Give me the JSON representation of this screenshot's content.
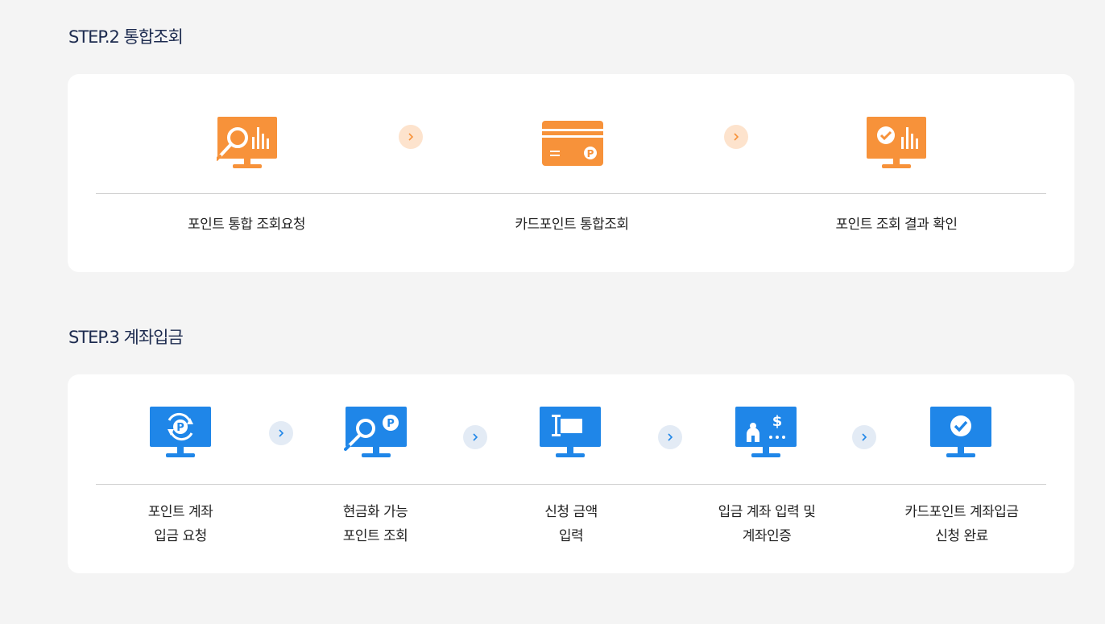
{
  "colors": {
    "background": "#f4f4f4",
    "card": "#ffffff",
    "step2_accent": "#f7923a",
    "step3_accent": "#1f86e8",
    "arrow_orange_bg": "#fde3cd",
    "arrow_blue_bg": "#e3ebf5",
    "title": "#1d2b4f"
  },
  "step2": {
    "title": "STEP.2 통합조회",
    "items": [
      {
        "icon": "monitor-search-chart-icon",
        "label": "포인트 통합 조회요청"
      },
      {
        "icon": "point-card-icon",
        "label": "카드포인트 통합조회"
      },
      {
        "icon": "monitor-check-chart-icon",
        "label": "포인트 조회 결과 확인"
      }
    ]
  },
  "step3": {
    "title": "STEP.3 계좌입금",
    "items": [
      {
        "icon": "monitor-point-refresh-icon",
        "line1": "포인트 계좌",
        "line2": "입금 요청"
      },
      {
        "icon": "monitor-search-point-icon",
        "line1": "현금화 가능",
        "line2": "포인트 조회"
      },
      {
        "icon": "monitor-input-icon",
        "line1": "신청 금액",
        "line2": "입력"
      },
      {
        "icon": "monitor-account-verify-icon",
        "line1": "입금 계좌 입력 및",
        "line2": "계좌인증"
      },
      {
        "icon": "monitor-check-icon",
        "line1": "카드포인트 계좌입금",
        "line2": "신청 완료"
      }
    ]
  }
}
